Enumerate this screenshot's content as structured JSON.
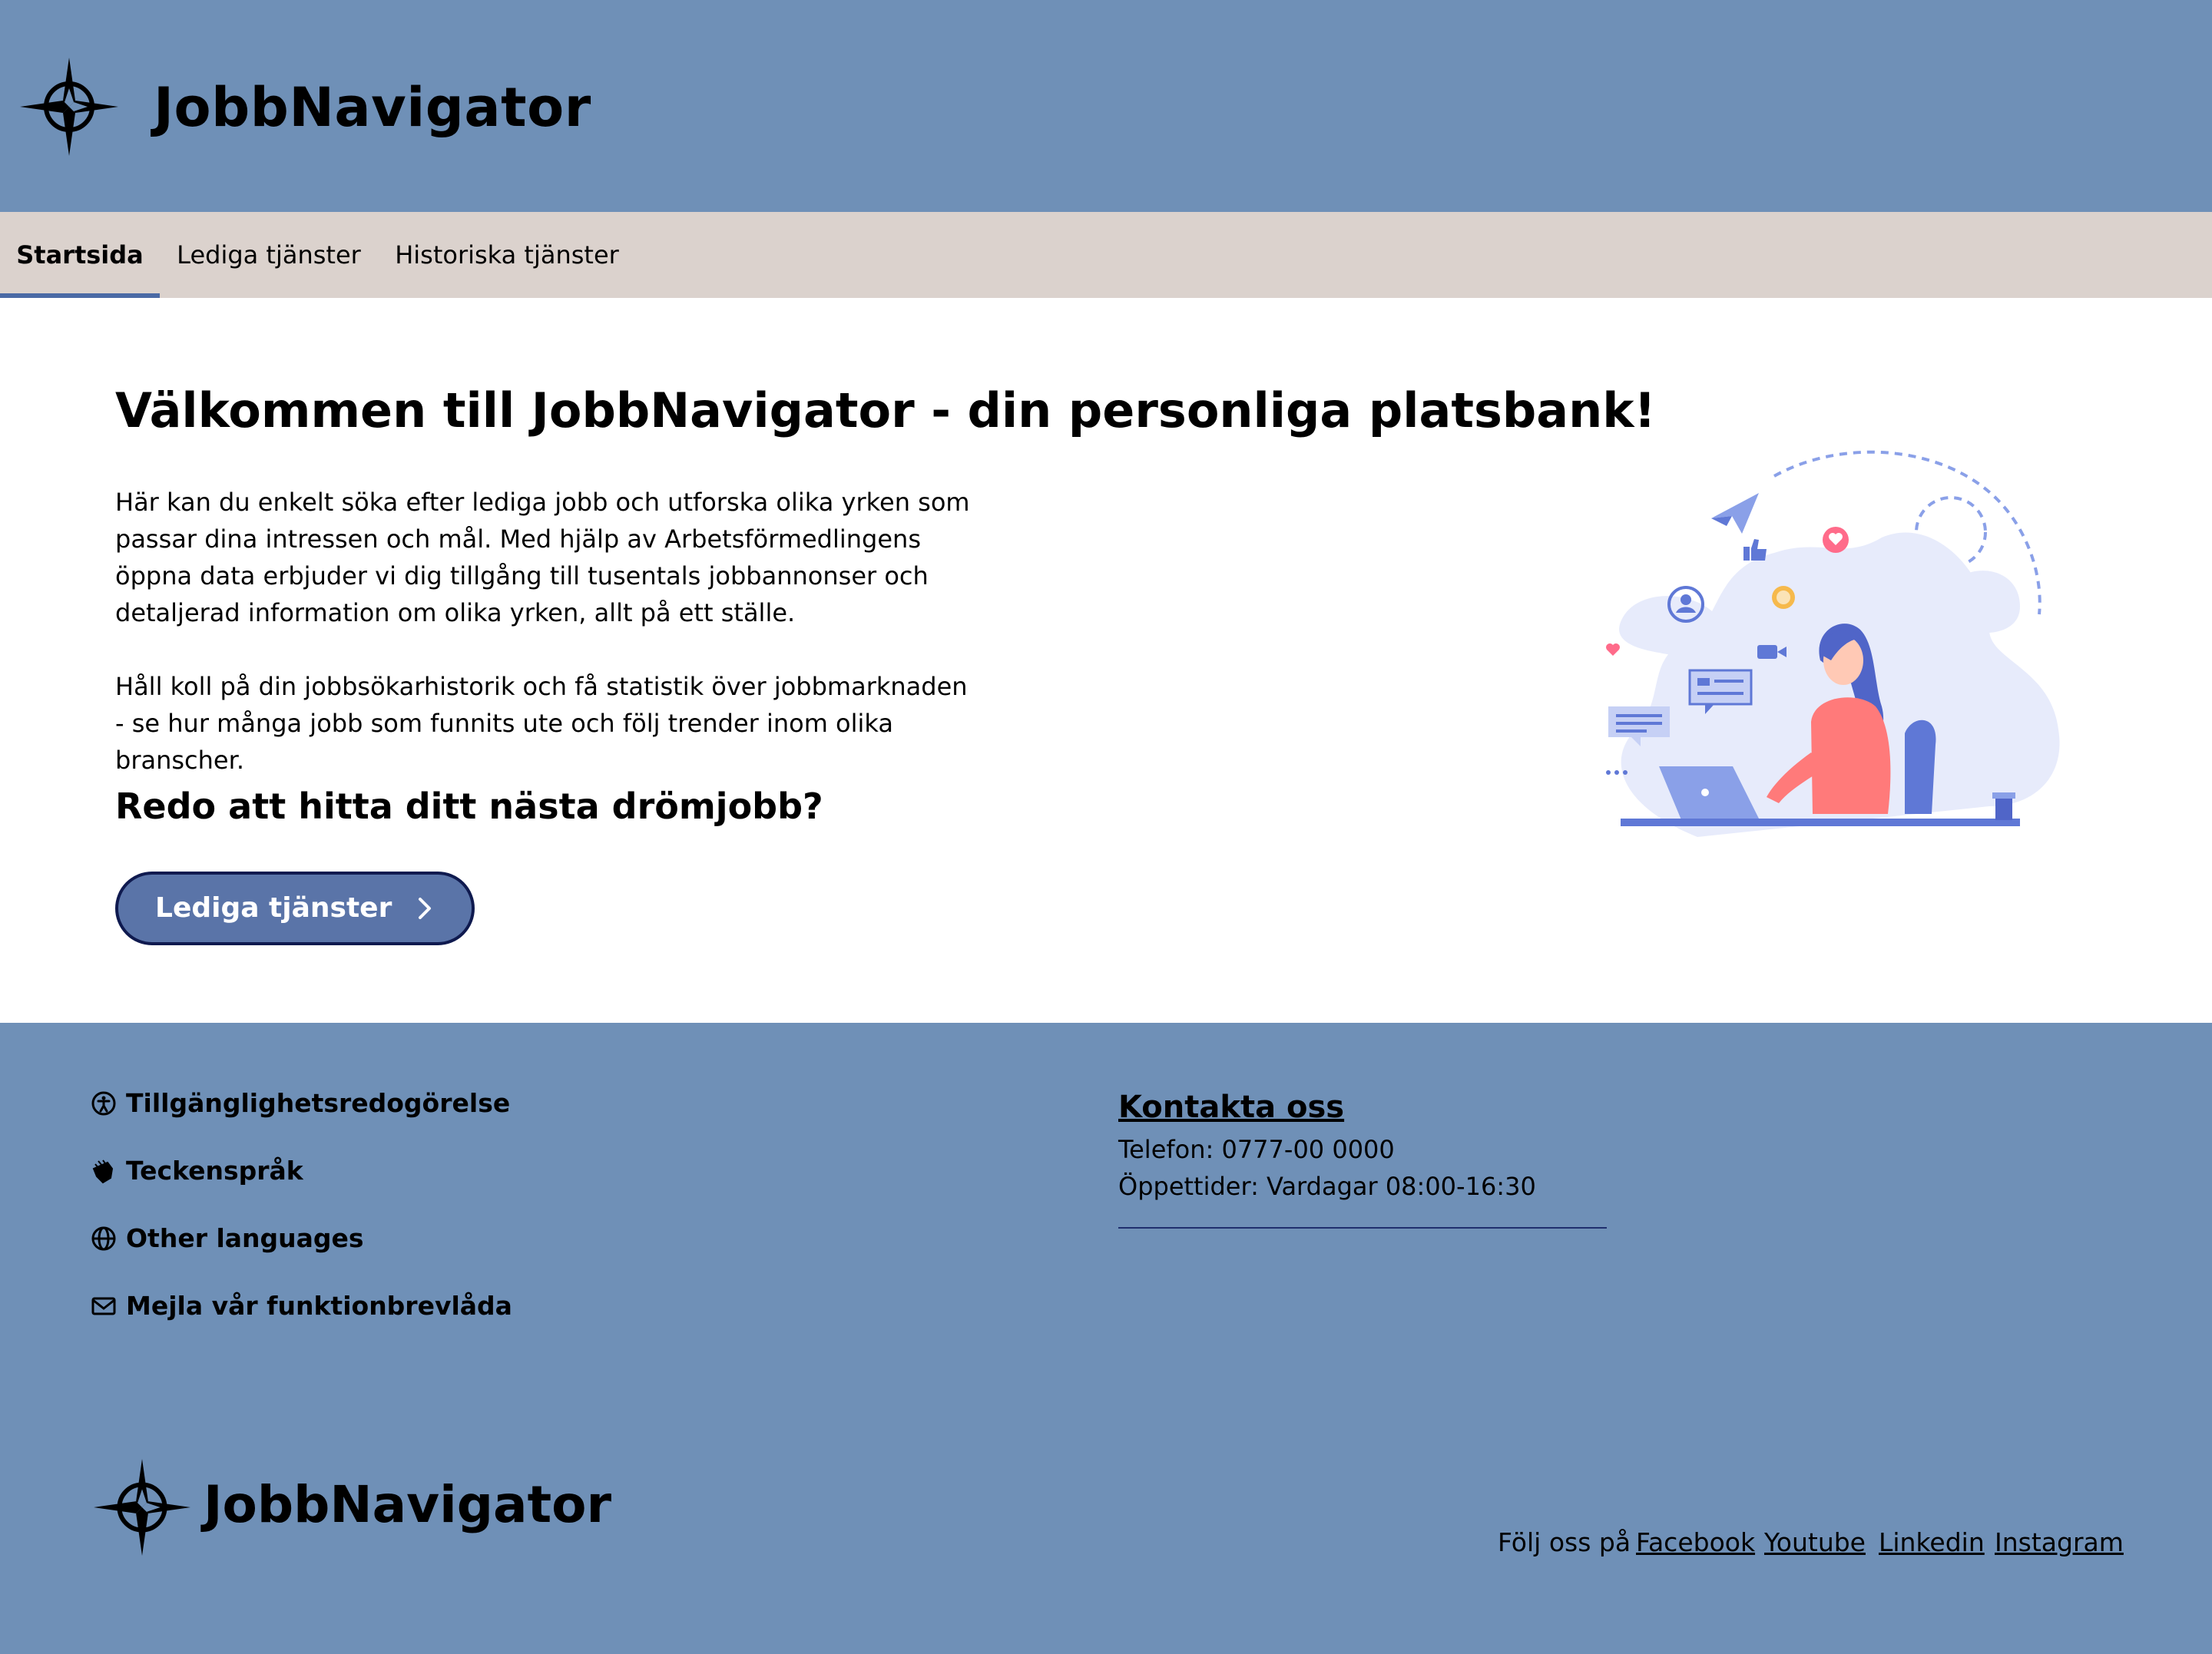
{
  "header": {
    "brand": "JobbNavigator",
    "logo_icon": "compass-icon"
  },
  "nav": {
    "tabs": [
      {
        "label": "Startsida",
        "active": true
      },
      {
        "label": "Lediga tjänster",
        "active": false
      },
      {
        "label": "Historiska tjänster",
        "active": false
      }
    ]
  },
  "main": {
    "title": "Välkommen till JobbNavigator - din personliga platsbank!",
    "paragraph1": "Här kan du enkelt söka efter lediga jobb och utforska olika yrken som passar dina intressen och mål. Med hjälp av Arbetsförmedlingens öppna data erbjuder vi dig tillgång till tusentals jobbannonser och detaljerad information om olika yrken, allt på ett ställe.",
    "paragraph2": "Håll koll på din jobbsökarhistorik och få statistik över jobbmarknaden - se hur många jobb som funnits ute och följ trender inom olika branscher.",
    "subheading": "Redo att hitta ditt nästa drömjobb?",
    "cta_label": "Lediga tjänster",
    "illustration": "woman-at-laptop-social-media-illustration"
  },
  "footer": {
    "links": [
      {
        "label": "Tillgänglighetsredogörelse",
        "icon": "accessibility-icon"
      },
      {
        "label": "Teckenspråk",
        "icon": "sign-language-icon"
      },
      {
        "label": "Other languages",
        "icon": "globe-icon"
      },
      {
        "label": "Mejla vår funktionbrevlåda",
        "icon": "mail-icon"
      }
    ],
    "contact": {
      "title": "Kontakta oss",
      "phone": "Telefon: 0777-00 0000",
      "hours": "Öppettider: Vardagar 08:00-16:30"
    },
    "brand": "JobbNavigator",
    "follow_label": "Följ oss på",
    "social": [
      "Facebook",
      "Youtube",
      "Linkedin",
      "Instagram"
    ]
  },
  "colors": {
    "header_bg": "#6f90b7",
    "nav_bg": "#dbd2cd",
    "cta_bg": "#5a74a8",
    "cta_border": "#0f1a4f",
    "active_tab_indicator": "#4a6aa5"
  }
}
